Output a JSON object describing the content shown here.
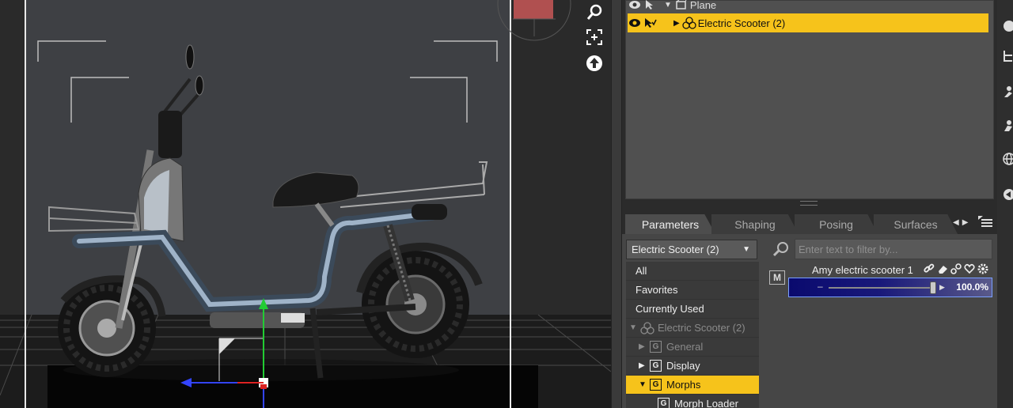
{
  "scene_tree": {
    "items": [
      {
        "label": "Plane",
        "selected": false
      },
      {
        "label": "Electric Scooter (2)",
        "selected": true
      }
    ]
  },
  "tabs": [
    {
      "label": "Parameters",
      "active": true
    },
    {
      "label": "Shaping",
      "active": false
    },
    {
      "label": "Posing",
      "active": false
    },
    {
      "label": "Surfaces",
      "active": false
    }
  ],
  "parameters": {
    "node_select": "Electric Scooter (2)",
    "filter_placeholder": "Enter text to filter by...",
    "categories": [
      {
        "label": "All"
      },
      {
        "label": "Favorites"
      },
      {
        "label": "Currently Used"
      },
      {
        "label": "Electric Scooter (2)"
      },
      {
        "label": "General"
      },
      {
        "label": "Display"
      },
      {
        "label": "Morphs"
      },
      {
        "label": "Morph Loader"
      }
    ],
    "property": {
      "badge": "M",
      "label": "Amy electric scooter 1",
      "value_text": "100.0%",
      "value": 1.0
    }
  },
  "colors": {
    "selection": "#f6c31b",
    "panel": "#505050",
    "viewport": "#2d2d2d",
    "slider_fill": "#0a0a6e"
  }
}
